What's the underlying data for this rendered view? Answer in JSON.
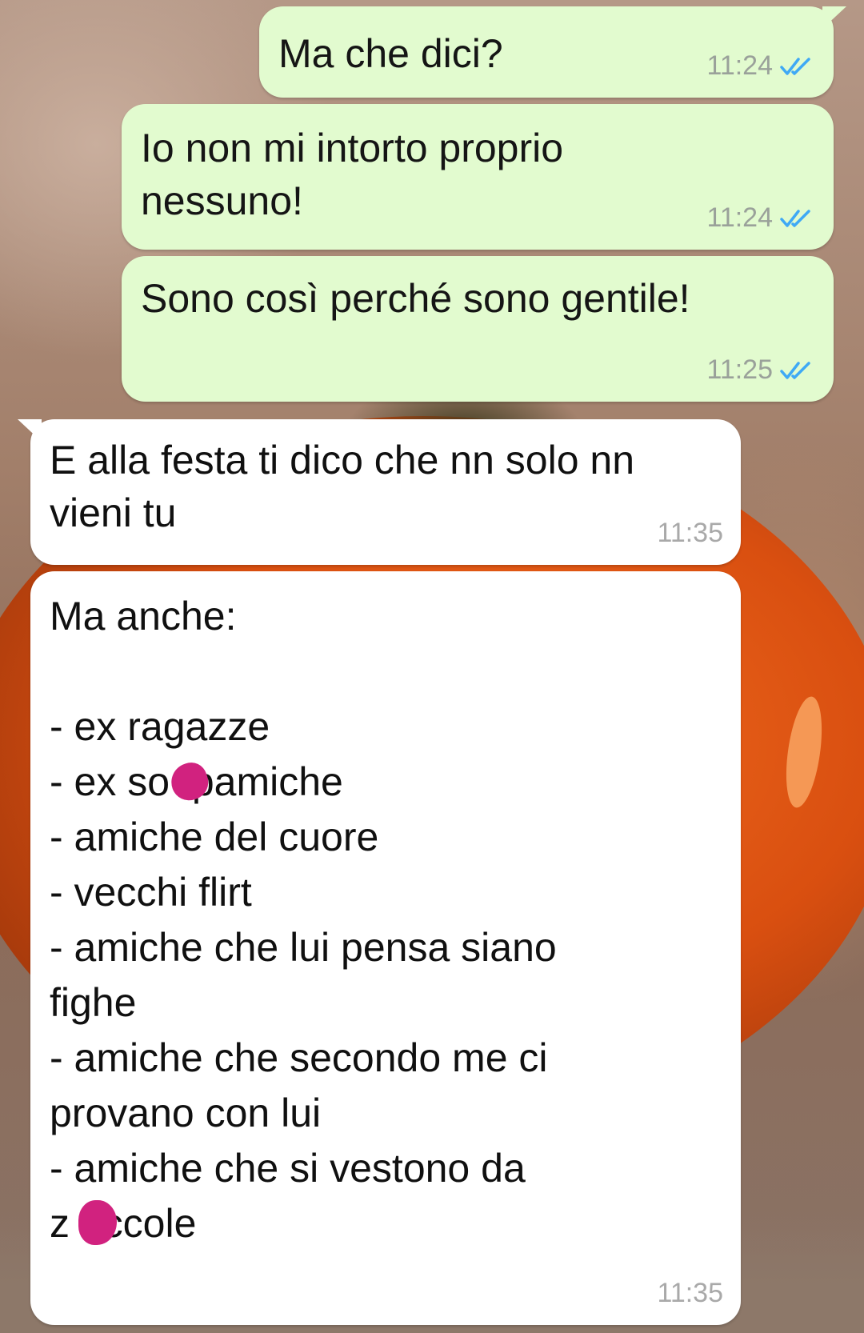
{
  "messages": [
    {
      "text": "Ma che dici?",
      "time": "11:24",
      "direction": "outgoing",
      "status": "read-double-check"
    },
    {
      "text": "Io non mi intorto proprio\nnessuno!",
      "time": "11:24",
      "direction": "outgoing",
      "status": "read-double-check"
    },
    {
      "text": "Sono così perché sono gentile!",
      "time": "11:25",
      "direction": "outgoing",
      "status": "read-double-check"
    },
    {
      "text": "E alla festa ti dico che nn solo nn\nvieni tu",
      "time": "11:35",
      "direction": "incoming"
    },
    {
      "text": "Ma anche:\n\n- ex ragazze\n- ex so  pamiche\n- amiche del cuore\n- vecchi flirt\n- amiche che lui pensa siano\nfighe\n- amiche che secondo me ci\nprovano con lui\n- amiche che si vestono da\nz   ccole",
      "time": "11:35",
      "direction": "incoming"
    }
  ],
  "colors": {
    "outgoing_bubble": "#e2fbcf",
    "incoming_bubble": "#ffffff",
    "read_ticks": "#3fa9f5",
    "redaction_blot": "#d1227f"
  },
  "icons": {
    "read_receipt": "double-check-icon",
    "redaction": "magenta-scribble-blot"
  }
}
